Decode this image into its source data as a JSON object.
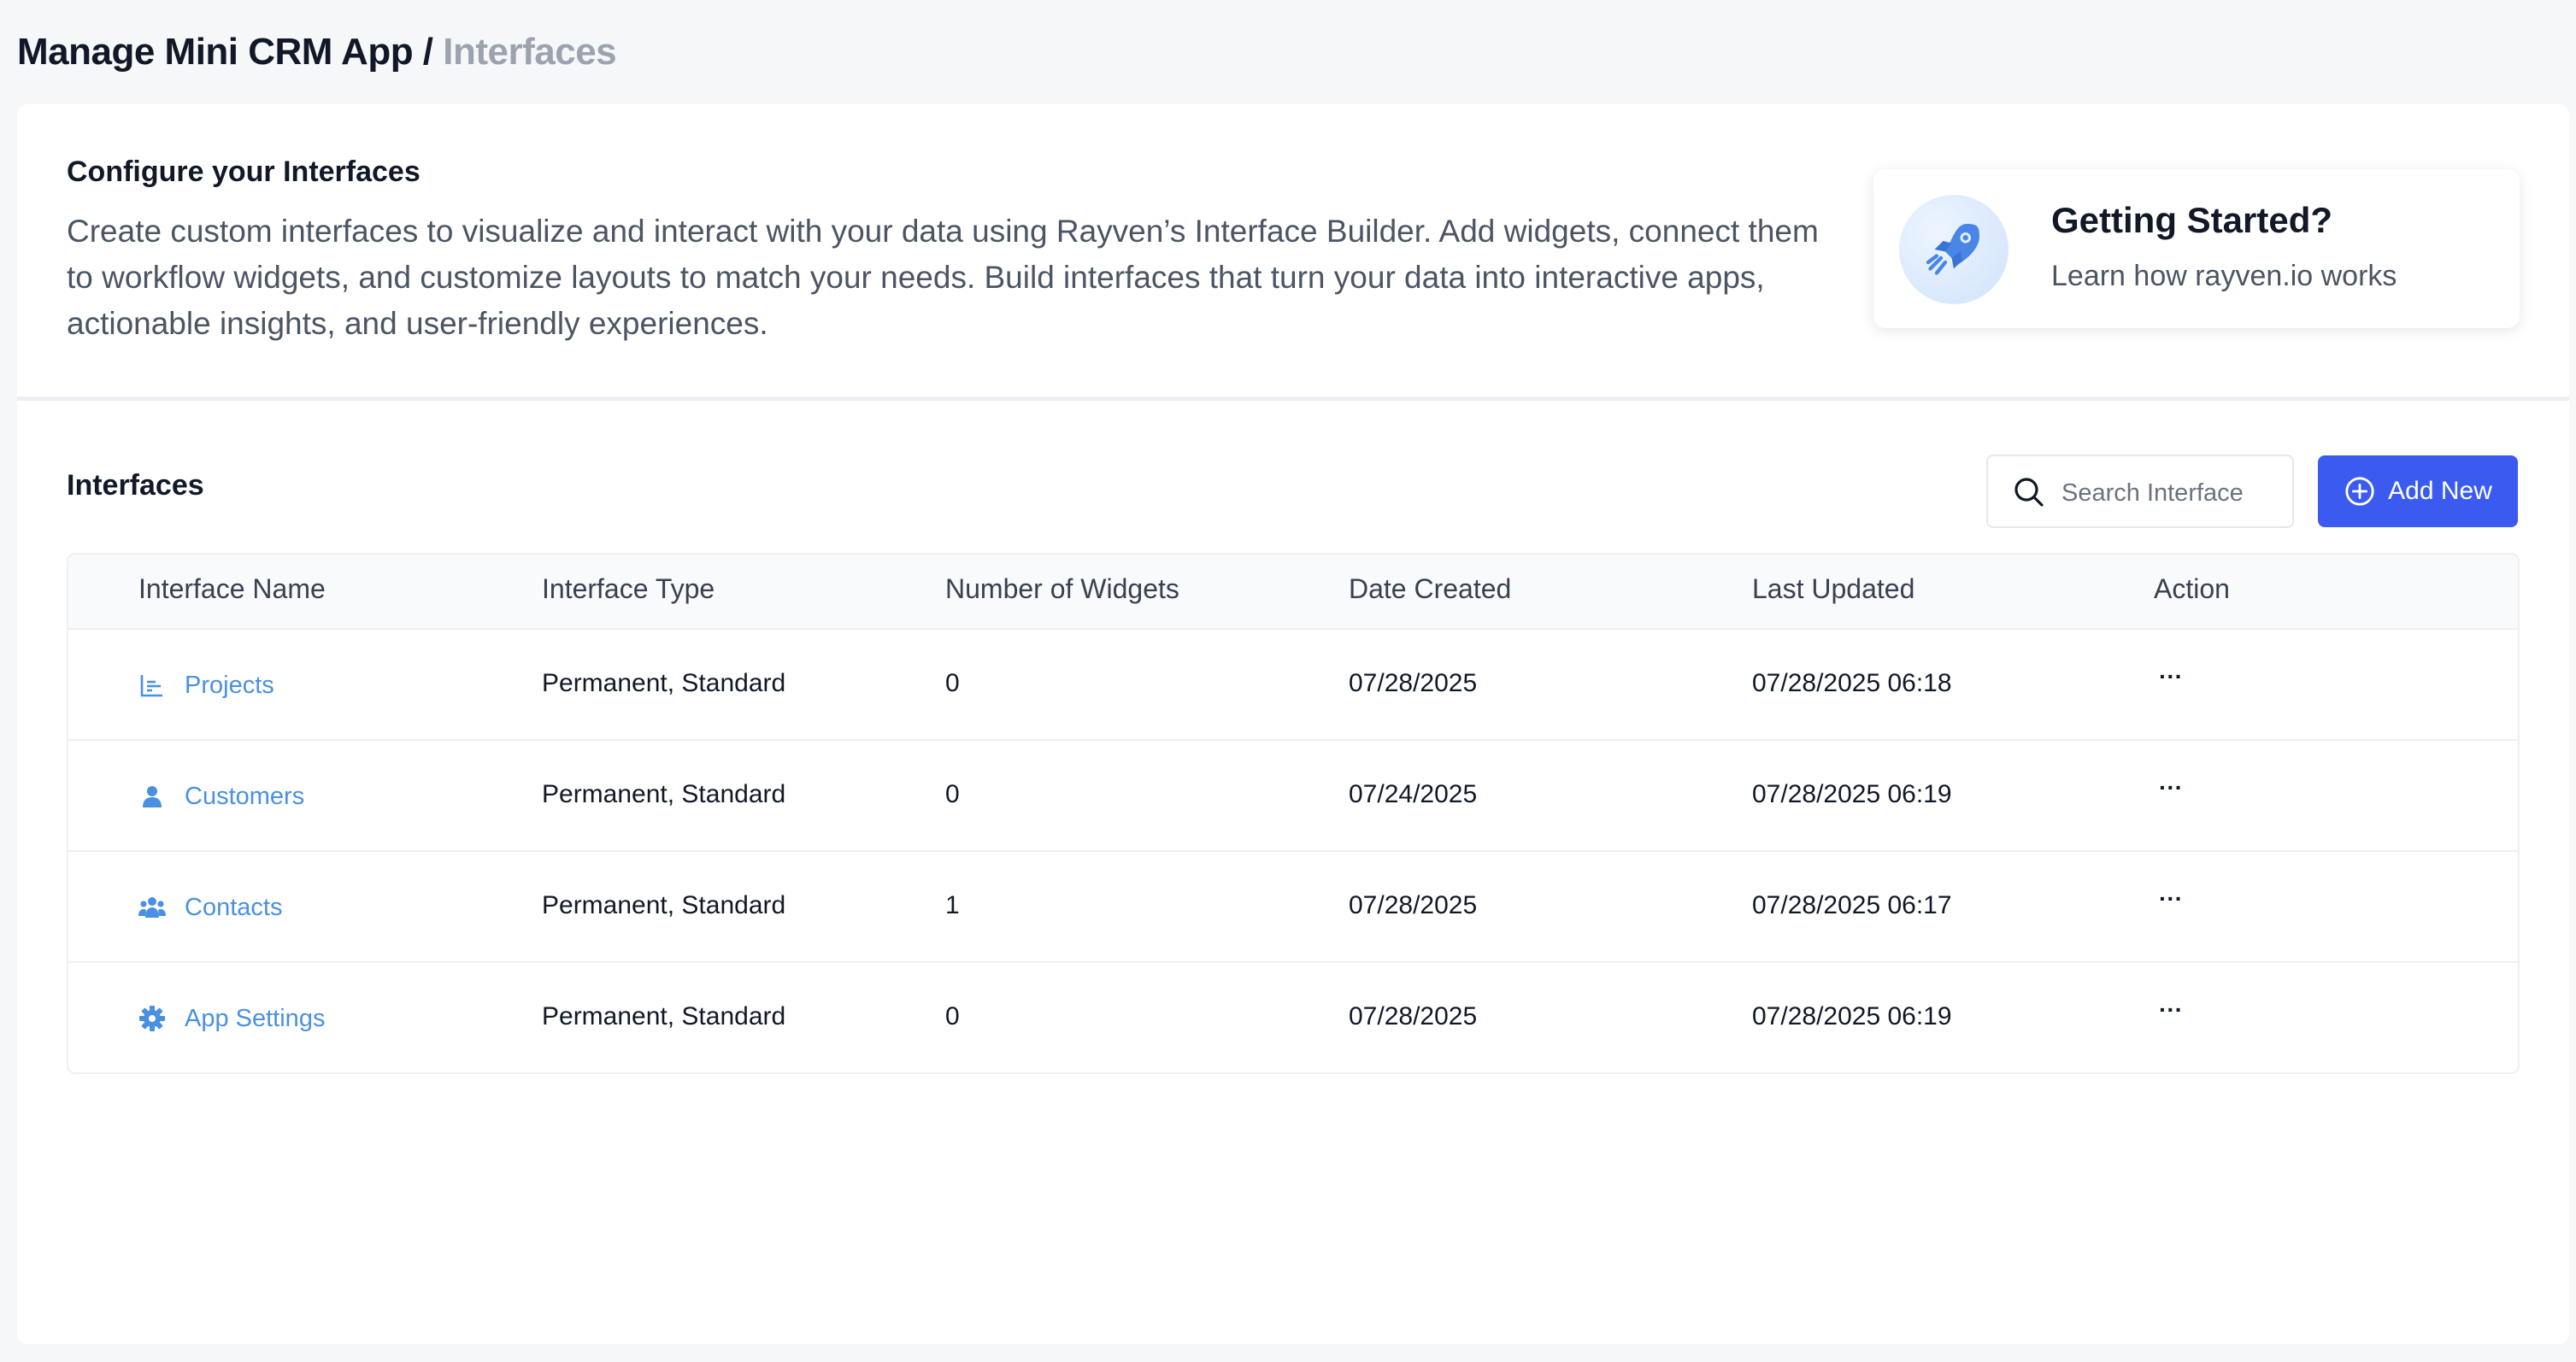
{
  "breadcrumb": {
    "parent": "Manage Mini CRM App /",
    "current": "Interfaces"
  },
  "intro": {
    "heading": "Configure your Interfaces",
    "description": "Create custom interfaces to visualize and interact with your data using Rayven’s Interface Builder. Add widgets, connect them to workflow widgets, and customize layouts to match your needs. Build interfaces that turn your data into interactive apps, actionable insights, and user-friendly experiences."
  },
  "getting_started": {
    "title": "Getting Started?",
    "subtitle": "Learn how rayven.io works",
    "icon": "rocket-icon"
  },
  "interfaces": {
    "title": "Interfaces",
    "search": {
      "placeholder": "Search Interface",
      "value": ""
    },
    "add_label": "Add New",
    "columns": [
      "Interface Name",
      "Interface Type",
      "Number of Widgets",
      "Date Created",
      "Last Updated",
      "Action"
    ],
    "rows": [
      {
        "name": "Projects",
        "icon": "bar-chart-icon",
        "type": "Permanent, Standard",
        "widgets": "0",
        "created": "07/28/2025",
        "updated": "07/28/2025 06:18",
        "action": "···"
      },
      {
        "name": "Customers",
        "icon": "user-icon",
        "type": "Permanent, Standard",
        "widgets": "0",
        "created": "07/24/2025",
        "updated": "07/28/2025 06:19",
        "action": "···"
      },
      {
        "name": "Contacts",
        "icon": "users-icon",
        "type": "Permanent, Standard",
        "widgets": "1",
        "created": "07/28/2025",
        "updated": "07/28/2025 06:17",
        "action": "···"
      },
      {
        "name": "App Settings",
        "icon": "gear-icon",
        "type": "Permanent, Standard",
        "widgets": "0",
        "created": "07/28/2025",
        "updated": "07/28/2025 06:19",
        "action": "···"
      }
    ]
  },
  "colors": {
    "accent": "#3b5bf0",
    "link": "#4a90e2",
    "muted": "#9ca3af"
  }
}
